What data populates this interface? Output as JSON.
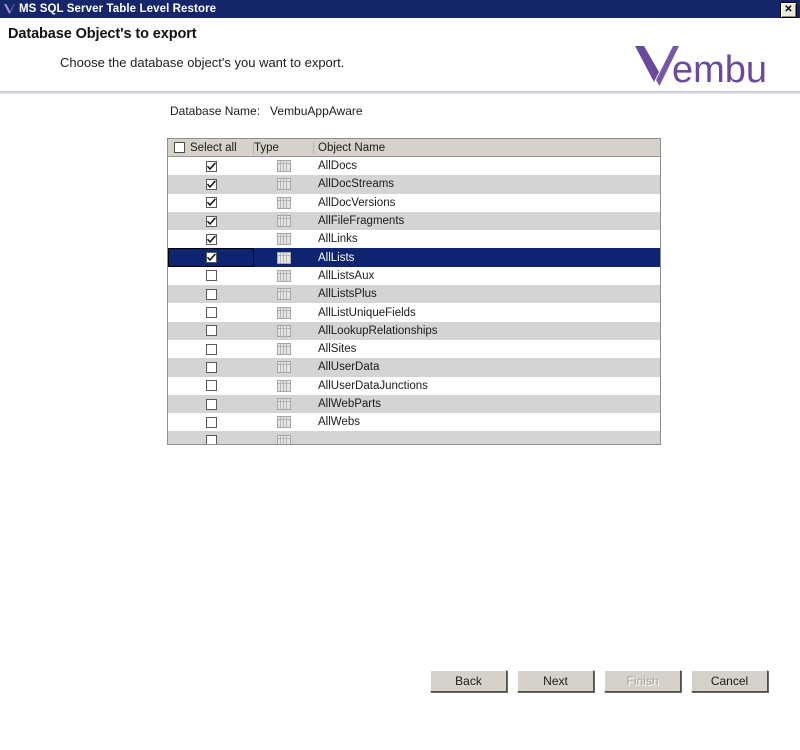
{
  "window": {
    "title": "MS SQL Server Table Level Restore",
    "logo_icon": "vembu-v-icon",
    "close_label": "✕",
    "close_icon": "close-icon",
    "titlebar_color": "#15266b"
  },
  "header": {
    "title": "Database Object's to export",
    "subtitle": "Choose the database object's you want to export.",
    "brand": "Vembu",
    "brand_color": "#6b4a9e",
    "divider_color": "#d8d2e2"
  },
  "database": {
    "label": "Database Name:",
    "value": "VembuAppAware"
  },
  "grid": {
    "columns": [
      "Select all",
      "Type",
      "Object Name"
    ],
    "select_all_checked": false,
    "type_icon": "table-grid-icon",
    "selection_color": "#0d2570",
    "rows": [
      {
        "name": "AllDocs",
        "checked": true,
        "selected": false
      },
      {
        "name": "AllDocStreams",
        "checked": true,
        "selected": false
      },
      {
        "name": "AllDocVersions",
        "checked": true,
        "selected": false
      },
      {
        "name": "AllFileFragments",
        "checked": true,
        "selected": false
      },
      {
        "name": "AllLinks",
        "checked": true,
        "selected": false
      },
      {
        "name": "AllLists",
        "checked": true,
        "selected": true
      },
      {
        "name": "AllListsAux",
        "checked": false,
        "selected": false
      },
      {
        "name": "AllListsPlus",
        "checked": false,
        "selected": false
      },
      {
        "name": "AllListUniqueFields",
        "checked": false,
        "selected": false
      },
      {
        "name": "AllLookupRelationships",
        "checked": false,
        "selected": false
      },
      {
        "name": "AllSites",
        "checked": false,
        "selected": false
      },
      {
        "name": "AllUserData",
        "checked": false,
        "selected": false
      },
      {
        "name": "AllUserDataJunctions",
        "checked": false,
        "selected": false
      },
      {
        "name": "AllWebParts",
        "checked": false,
        "selected": false
      },
      {
        "name": "AllWebs",
        "checked": false,
        "selected": false
      },
      {
        "name": "",
        "checked": false,
        "selected": false
      }
    ],
    "scrollbar": {
      "up_icon": "scroll-up-arrow-icon",
      "down_icon": "scroll-down-arrow-icon"
    }
  },
  "footer": {
    "back": "Back",
    "next": "Next",
    "finish": "Finish",
    "finish_disabled": true,
    "cancel": "Cancel"
  }
}
